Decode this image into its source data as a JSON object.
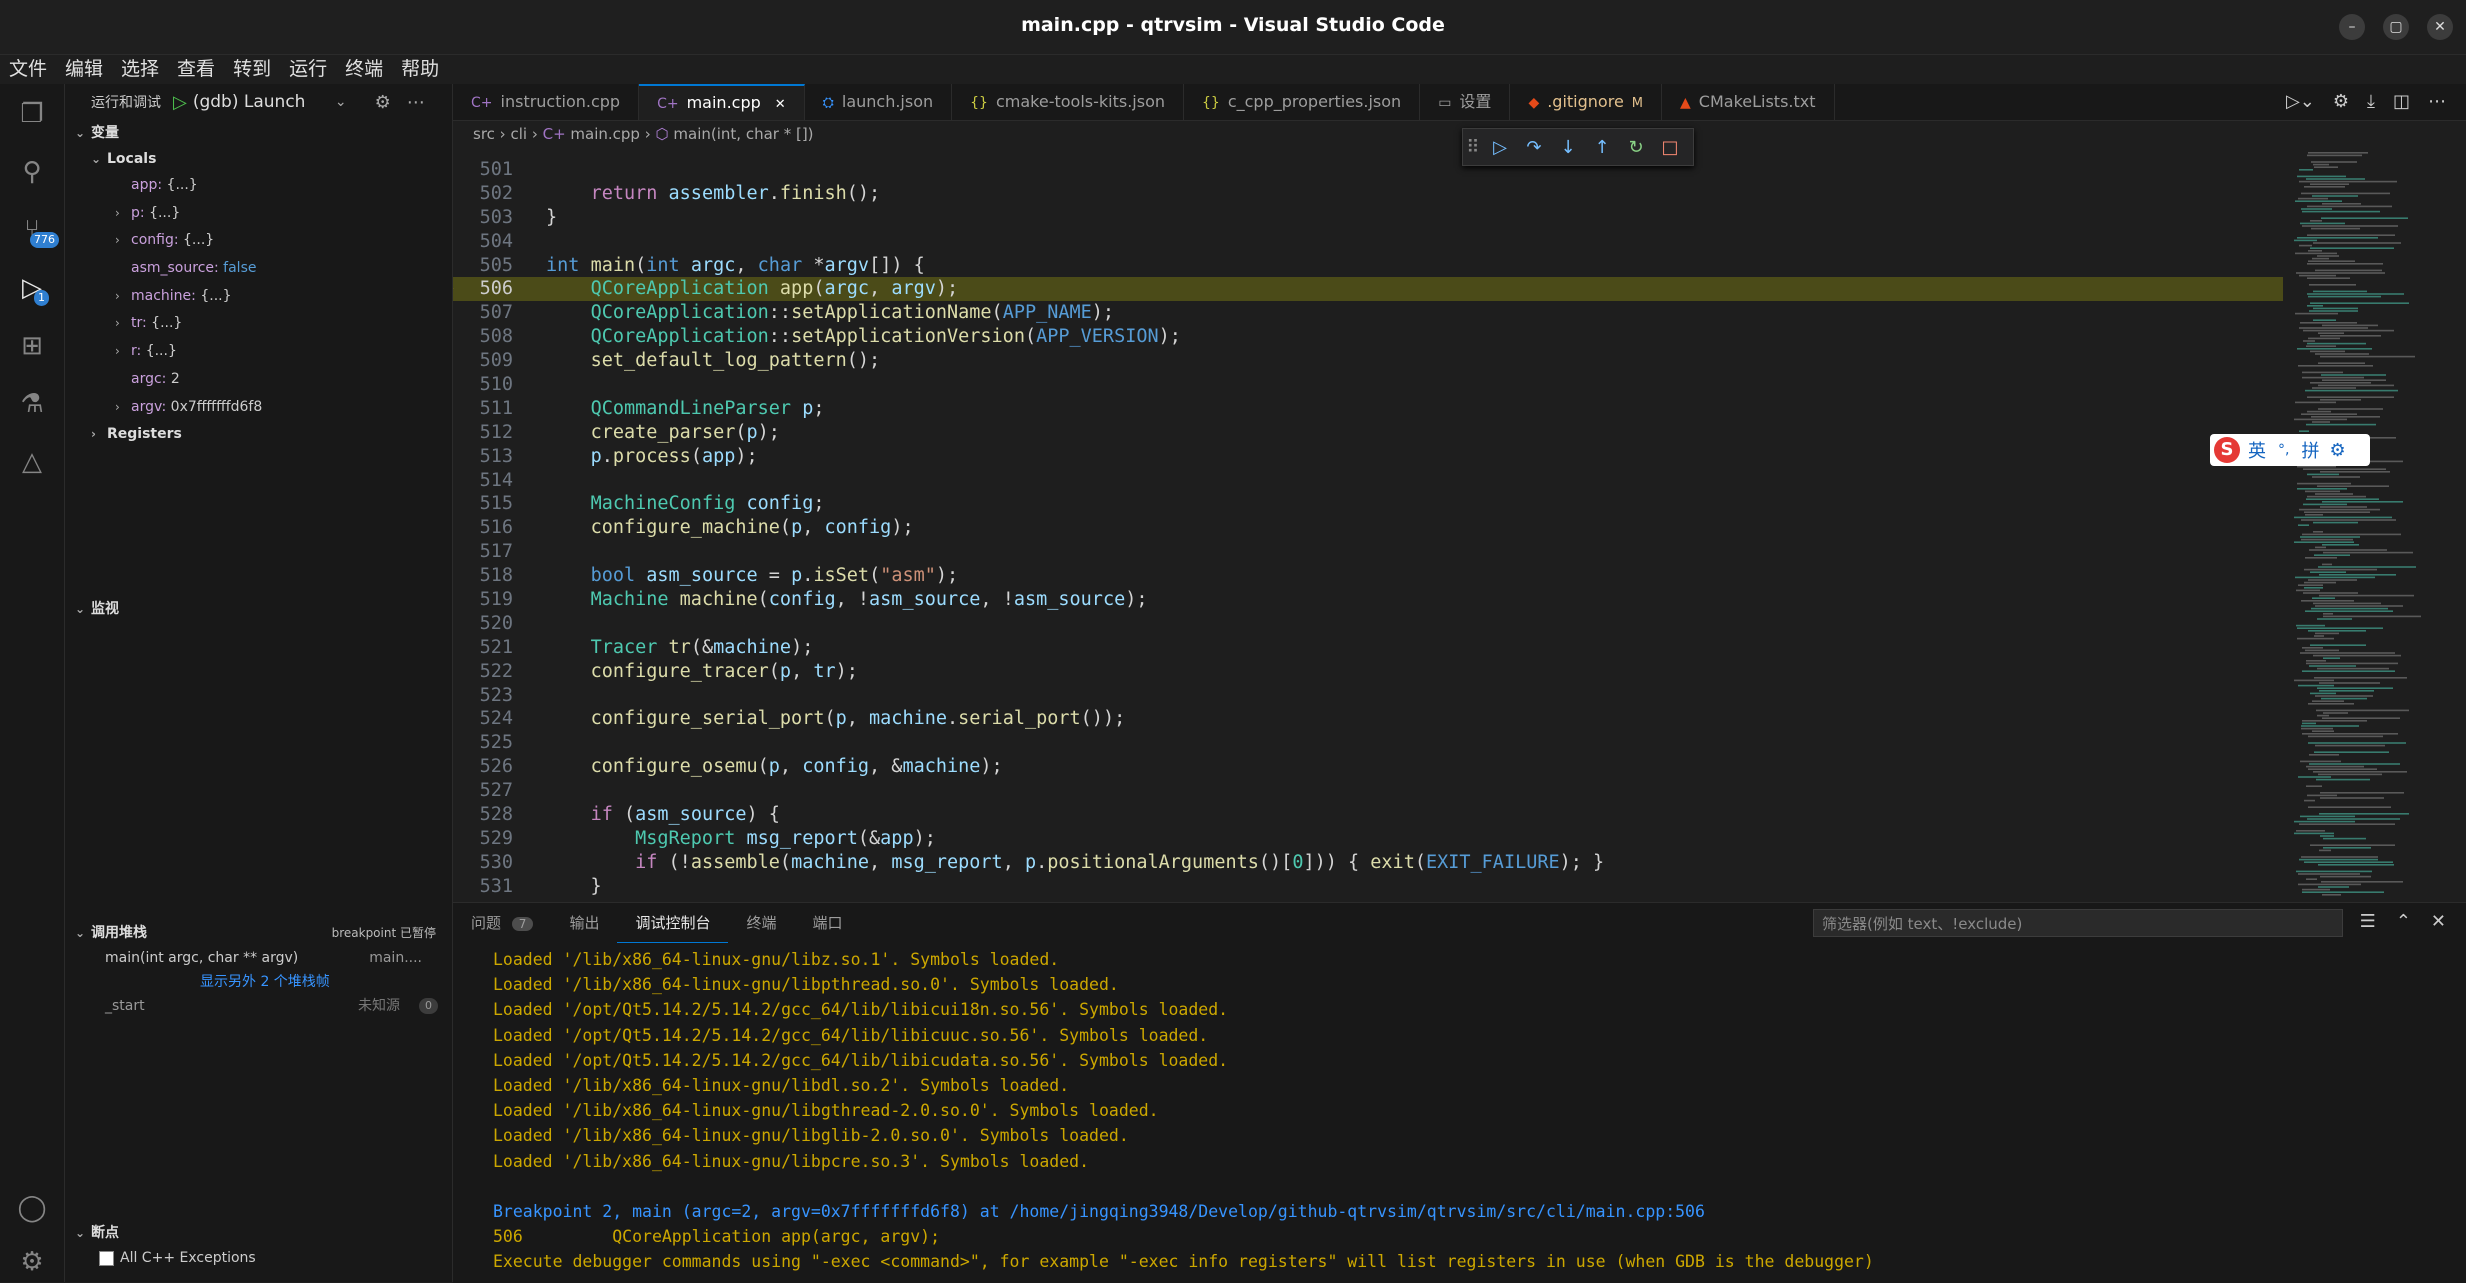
{
  "window": {
    "title": "main.cpp - qtrvsim - Visual Studio Code",
    "controls": [
      "–",
      "▢",
      "✕"
    ]
  },
  "menu": [
    "文件",
    "编辑",
    "选择",
    "查看",
    "转到",
    "运行",
    "终端",
    "帮助"
  ],
  "activity": {
    "scm_badge": "776",
    "debug_badge": "1"
  },
  "sidebar": {
    "title": "运行和调试",
    "launch_config": "(gdb) Launch",
    "variables_header": "变量",
    "locals_header": "Locals",
    "locals": [
      {
        "name": "app:",
        "value": "{...}",
        "expandable": false
      },
      {
        "name": "p:",
        "value": "{...}",
        "expandable": true
      },
      {
        "name": "config:",
        "value": "{...}",
        "expandable": true
      },
      {
        "name": "asm_source:",
        "value": "false",
        "expandable": false
      },
      {
        "name": "machine:",
        "value": "{...}",
        "expandable": true
      },
      {
        "name": "tr:",
        "value": "{...}",
        "expandable": true
      },
      {
        "name": "r:",
        "value": "{...}",
        "expandable": true
      },
      {
        "name": "argc:",
        "value": "2",
        "expandable": false
      },
      {
        "name": "argv:",
        "value": "0x7fffffffd6f8",
        "expandable": true
      }
    ],
    "registers_header": "Registers",
    "watch_header": "监视",
    "callstack_header": "调用堆栈",
    "callstack_status": "breakpoint 已暂停",
    "callstack": {
      "frame1": "main(int argc, char ** argv)",
      "frame1_src": "main....",
      "show_more": "显示另外 2 个堆栈帧",
      "frame2": "_start",
      "frame2_src": "未知源",
      "frame2_badge": "0"
    },
    "breakpoints_header": "断点",
    "breakpoint_item": "All C++ Exceptions"
  },
  "tabs": [
    {
      "label": "instruction.cpp",
      "icon": "C+",
      "active": false
    },
    {
      "label": "main.cpp",
      "icon": "C+",
      "active": true,
      "close": "✕"
    },
    {
      "label": "launch.json",
      "icon": "⛭",
      "active": false
    },
    {
      "label": "cmake-tools-kits.json",
      "icon": "{}",
      "active": false
    },
    {
      "label": "c_cpp_properties.json",
      "icon": "{}",
      "active": false
    },
    {
      "label": "设置",
      "icon": "▭",
      "active": false
    },
    {
      "label": ".gitignore",
      "icon": "◆",
      "active": false,
      "badge": "M"
    },
    {
      "label": "CMakeLists.txt",
      "icon": "▲",
      "active": false
    }
  ],
  "breadcrumb": {
    "p1": "src",
    "p2": "cli",
    "p3": "main.cpp",
    "p4": "main(int, char * [])"
  },
  "code": [
    {
      "n": "501",
      "html": ""
    },
    {
      "n": "502",
      "html": "    <span class='t-ctl'>return</span> <span class='t-var'>assembler</span>.<span class='t-fn'>finish</span>();"
    },
    {
      "n": "503",
      "html": "}"
    },
    {
      "n": "504",
      "html": ""
    },
    {
      "n": "505",
      "html": "<span class='t-kw'>int</span> <span class='t-fn'>main</span>(<span class='t-kw'>int</span> <span class='t-var'>argc</span>, <span class='t-kw'>char</span> *<span class='t-var'>argv</span>[]) {"
    },
    {
      "n": "506",
      "html": "    <span class='t-cls'>QCoreApplication</span> <span class='t-fn'>app</span>(<span class='t-var'>argc</span>, <span class='t-var'>argv</span>);",
      "current": true
    },
    {
      "n": "507",
      "html": "    <span class='t-cls'>QCoreApplication</span>::<span class='t-fn'>setApplicationName</span>(<span class='t-mac'>APP_NAME</span>);"
    },
    {
      "n": "508",
      "html": "    <span class='t-cls'>QCoreApplication</span>::<span class='t-fn'>setApplicationVersion</span>(<span class='t-mac'>APP_VERSION</span>);"
    },
    {
      "n": "509",
      "html": "    <span class='t-fn'>set_default_log_pattern</span>();"
    },
    {
      "n": "510",
      "html": ""
    },
    {
      "n": "511",
      "html": "    <span class='t-cls'>QCommandLineParser</span> <span class='t-var'>p</span>;"
    },
    {
      "n": "512",
      "html": "    <span class='t-fn'>create_parser</span>(<span class='t-var'>p</span>);"
    },
    {
      "n": "513",
      "html": "    <span class='t-var'>p</span>.<span class='t-fn'>process</span>(<span class='t-var'>app</span>);"
    },
    {
      "n": "514",
      "html": ""
    },
    {
      "n": "515",
      "html": "    <span class='t-cls'>MachineConfig</span> <span class='t-var'>config</span>;"
    },
    {
      "n": "516",
      "html": "    <span class='t-fn'>configure_machine</span>(<span class='t-var'>p</span>, <span class='t-var'>config</span>);"
    },
    {
      "n": "517",
      "html": ""
    },
    {
      "n": "518",
      "html": "    <span class='t-kw'>bool</span> <span class='t-var'>asm_source</span> = <span class='t-var'>p</span>.<span class='t-fn'>isSet</span>(<span class='t-str'>\"asm\"</span>);"
    },
    {
      "n": "519",
      "html": "    <span class='t-cls'>Machine</span> <span class='t-fn'>machine</span>(<span class='t-var'>config</span>, !<span class='t-var'>asm_source</span>, !<span class='t-var'>asm_source</span>);"
    },
    {
      "n": "520",
      "html": ""
    },
    {
      "n": "521",
      "html": "    <span class='t-cls'>Tracer</span> <span class='t-fn'>tr</span>(&amp;<span class='t-var'>machine</span>);"
    },
    {
      "n": "522",
      "html": "    <span class='t-fn'>configure_tracer</span>(<span class='t-var'>p</span>, <span class='t-var'>tr</span>);"
    },
    {
      "n": "523",
      "html": ""
    },
    {
      "n": "524",
      "html": "    <span class='t-fn'>configure_serial_port</span>(<span class='t-var'>p</span>, <span class='t-var'>machine</span>.<span class='t-fn'>serial_port</span>());"
    },
    {
      "n": "525",
      "html": ""
    },
    {
      "n": "526",
      "html": "    <span class='t-fn'>configure_osemu</span>(<span class='t-var'>p</span>, <span class='t-var'>config</span>, &amp;<span class='t-var'>machine</span>);"
    },
    {
      "n": "527",
      "html": ""
    },
    {
      "n": "528",
      "html": "    <span class='t-ctl'>if</span> (<span class='t-var'>asm_source</span>) {"
    },
    {
      "n": "529",
      "html": "        <span class='t-cls'>MsgReport</span> <span class='t-var'>msg_report</span>(&amp;<span class='t-var'>app</span>);"
    },
    {
      "n": "530",
      "html": "        <span class='t-ctl'>if</span> (!<span class='t-fn'>assemble</span>(<span class='t-var'>machine</span>, <span class='t-var'>msg_report</span>, <span class='t-var'>p</span>.<span class='t-fn'>positionalArguments</span>()[<span class='t-cls'>0</span>])) { <span class='t-fn'>exit</span>(<span class='t-mac'>EXIT_FAILURE</span>); }"
    },
    {
      "n": "531",
      "html": "    }"
    }
  ],
  "panel": {
    "tabs": [
      "问题",
      "输出",
      "调试控制台",
      "终端",
      "端口"
    ],
    "problems_count": "7",
    "filter_placeholder": "筛选器(例如 text、!exclude)",
    "console": [
      {
        "text": "Loaded '/lib/x86_64-linux-gnu/libz.so.1'. Symbols loaded.",
        "color": "y"
      },
      {
        "text": "Loaded '/lib/x86_64-linux-gnu/libpthread.so.0'. Symbols loaded.",
        "color": "y"
      },
      {
        "text": "Loaded '/opt/Qt5.14.2/5.14.2/gcc_64/lib/libicui18n.so.56'. Symbols loaded.",
        "color": "y"
      },
      {
        "text": "Loaded '/opt/Qt5.14.2/5.14.2/gcc_64/lib/libicuuc.so.56'. Symbols loaded.",
        "color": "y"
      },
      {
        "text": "Loaded '/opt/Qt5.14.2/5.14.2/gcc_64/lib/libicudata.so.56'. Symbols loaded.",
        "color": "y"
      },
      {
        "text": "Loaded '/lib/x86_64-linux-gnu/libdl.so.2'. Symbols loaded.",
        "color": "y"
      },
      {
        "text": "Loaded '/lib/x86_64-linux-gnu/libgthread-2.0.so.0'. Symbols loaded.",
        "color": "y"
      },
      {
        "text": "Loaded '/lib/x86_64-linux-gnu/libglib-2.0.so.0'. Symbols loaded.",
        "color": "y"
      },
      {
        "text": "Loaded '/lib/x86_64-linux-gnu/libpcre.so.3'. Symbols loaded.",
        "color": "y"
      },
      {
        "text": "",
        "color": "y"
      },
      {
        "text": "Breakpoint 2, main (argc=2, argv=0x7fffffffd6f8) at /home/jingqing3948/Develop/github-qtrvsim/qtrvsim/src/cli/main.cpp:506",
        "color": "b"
      },
      {
        "text": "506         QCoreApplication app(argc, argv);",
        "color": "y"
      },
      {
        "text": "Execute debugger commands using \"-exec <command>\", for example \"-exec info registers\" will list registers in use (when GDB is the debugger)",
        "color": "y"
      }
    ]
  },
  "ime": {
    "mode": "英",
    "punct": "°,",
    "pinyin": "拼"
  },
  "colors": {
    "accent": "#0078d4",
    "current_line": "#4b4b18",
    "console_yellow": "#cca700",
    "console_blue": "#3794ff"
  }
}
